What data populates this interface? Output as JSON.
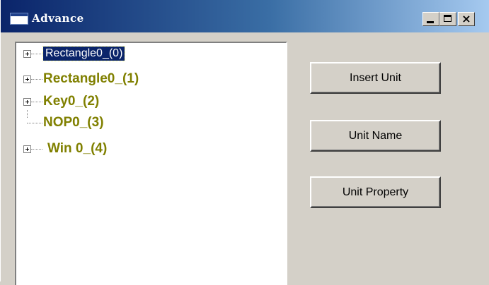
{
  "window": {
    "title": "Advance",
    "controls": {
      "minimize": "_",
      "maximize": "□",
      "close": "×"
    }
  },
  "tree": {
    "items": [
      {
        "label": "Rectangle0_(0)",
        "expandable": true,
        "selected": true
      },
      {
        "label": "Rectangle0_(1)",
        "expandable": true,
        "selected": false
      },
      {
        "label": "Key0_(2)",
        "expandable": true,
        "selected": false
      },
      {
        "label": "NOP0_(3)",
        "expandable": false,
        "selected": false
      },
      {
        "label": "Win 0_(4)",
        "expandable": true,
        "selected": false
      }
    ]
  },
  "buttons": {
    "insert_unit": "Insert Unit",
    "unit_name": "Unit Name",
    "unit_property": "Unit Property"
  },
  "colors": {
    "titlebar_start": "#0a246a",
    "titlebar_end": "#a6caf0",
    "selection": "#0a246a",
    "tree_item_text": "#808000",
    "face": "#d4d0c8"
  }
}
